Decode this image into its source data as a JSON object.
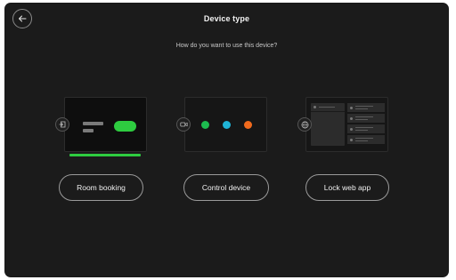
{
  "header": {
    "title": "Device type",
    "subtitle": "How do you want to use this device?"
  },
  "back_icon": "arrow-left-icon",
  "options": [
    {
      "label": "Room booking",
      "icon": "sign-in-icon",
      "selected": true
    },
    {
      "label": "Control device",
      "icon": "camera-icon"
    },
    {
      "label": "Lock web app",
      "icon": "globe-icon"
    }
  ],
  "colors": {
    "selected_accent": "#2ecc40",
    "dot_green": "#1dbb4f",
    "dot_blue": "#1fb3d6",
    "dot_orange": "#f06a1d"
  }
}
